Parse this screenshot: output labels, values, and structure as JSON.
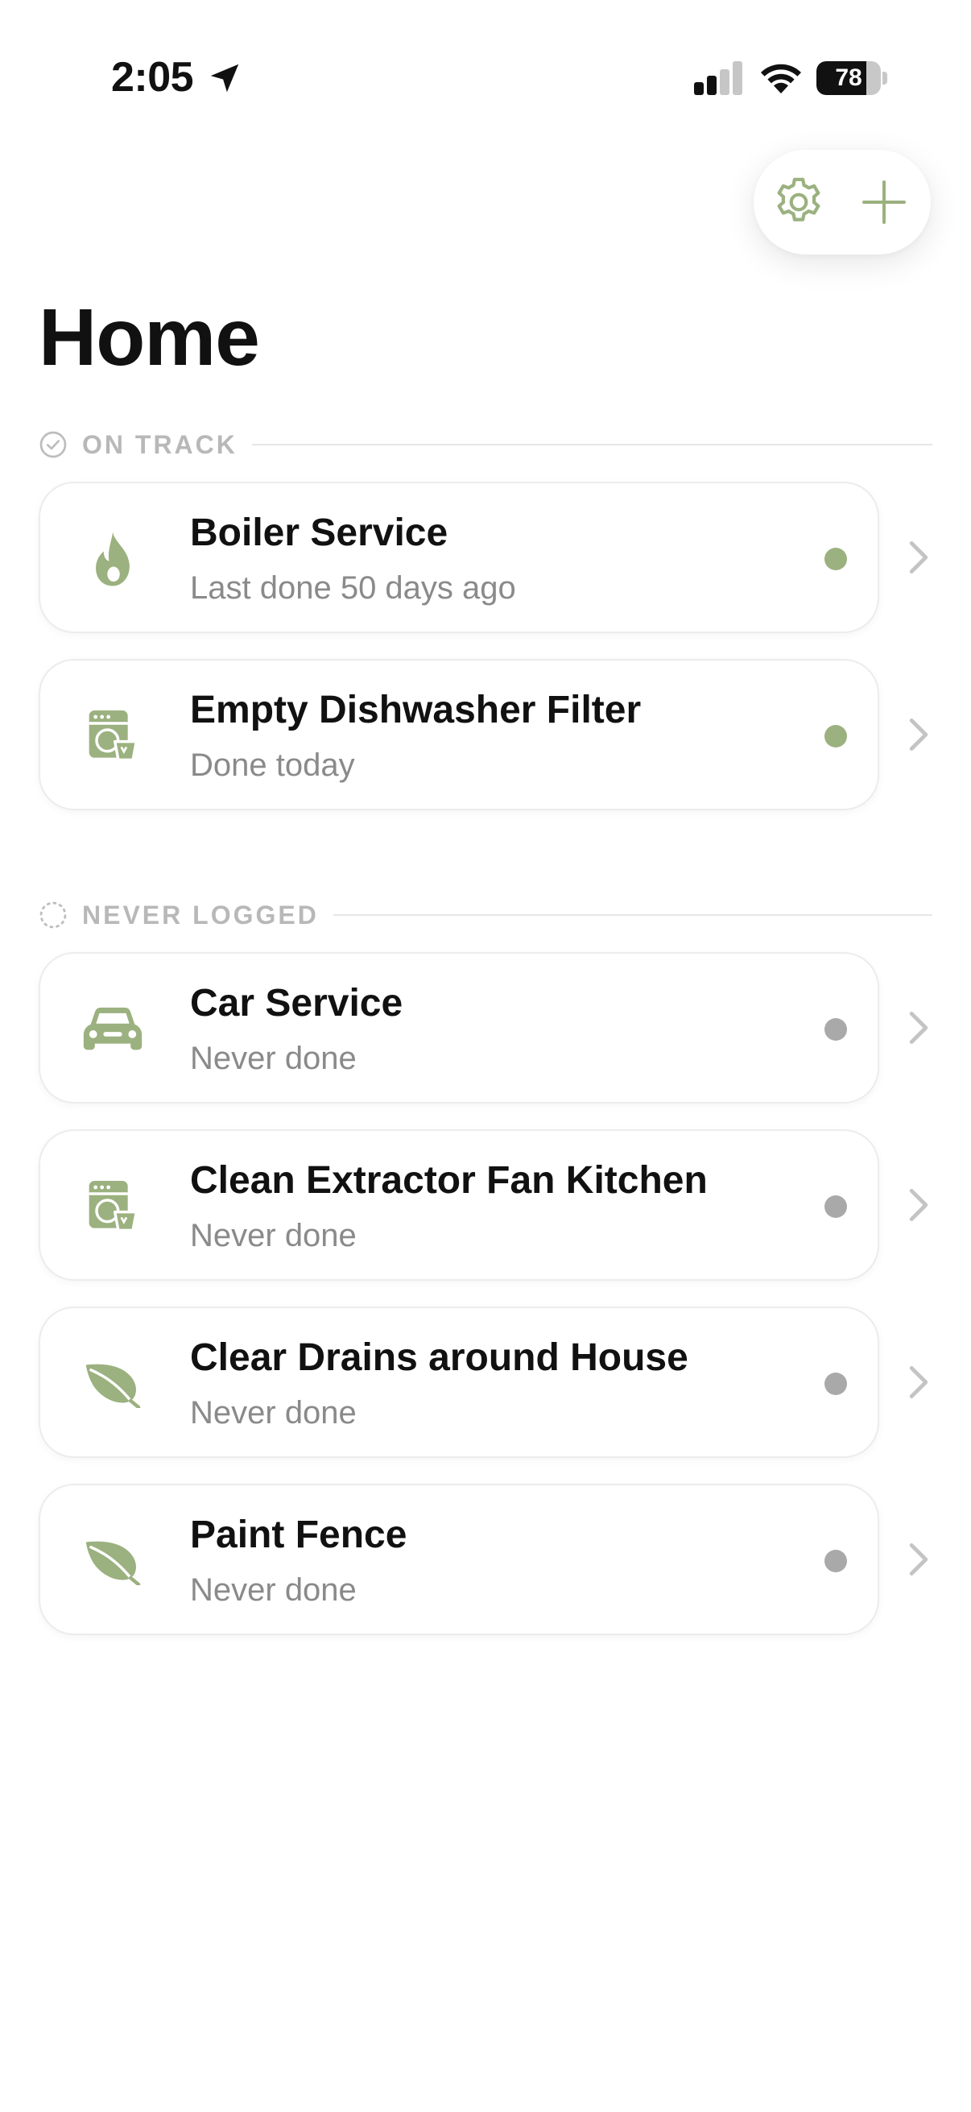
{
  "status_bar": {
    "time": "2:05",
    "battery": "78",
    "battery_level": 0.78
  },
  "colors": {
    "accent": "#9bb17f",
    "on_track_dot": "#9bb17f",
    "never_dot": "#a9a9a9",
    "section_label": "#b8b8b8"
  },
  "page": {
    "title": "Home"
  },
  "sections": [
    {
      "label": "ON TRACK",
      "icon": "check-circle-icon",
      "items": [
        {
          "title": "Boiler Service",
          "subtitle": "Last done 50 days ago",
          "icon": "flame-icon",
          "status": "on-track"
        },
        {
          "title": "Empty Dishwasher Filter",
          "subtitle": "Done today",
          "icon": "dishwasher-icon",
          "status": "on-track"
        }
      ]
    },
    {
      "label": "NEVER LOGGED",
      "icon": "dashed-circle-icon",
      "items": [
        {
          "title": "Car Service",
          "subtitle": "Never done",
          "icon": "car-icon",
          "status": "never"
        },
        {
          "title": "Clean Extractor Fan Kitchen",
          "subtitle": "Never done",
          "icon": "dishwasher-icon",
          "status": "never"
        },
        {
          "title": "Clear Drains around House",
          "subtitle": "Never done",
          "icon": "leaf-icon",
          "status": "never"
        },
        {
          "title": "Paint Fence",
          "subtitle": "Never done",
          "icon": "leaf-icon",
          "status": "never"
        }
      ]
    }
  ]
}
